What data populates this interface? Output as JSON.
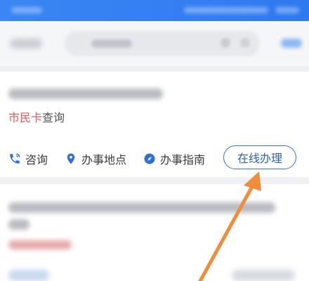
{
  "card1": {
    "tag_red": "市民卡",
    "tag_rest": "查询",
    "actions": [
      {
        "label": "咨询",
        "icon": "phone-icon"
      },
      {
        "label": "办事地点",
        "icon": "location-pin-icon"
      },
      {
        "label": "办事指南",
        "icon": "compass-icon"
      }
    ],
    "primary_button": "在线办理"
  },
  "colors": {
    "header_blue": "#3a86f4",
    "tag_red": "#e35a5a",
    "button_blue": "#2f5fb0",
    "arrow_orange": "#f08c3a",
    "icon_blue": "#2f6fd6"
  }
}
